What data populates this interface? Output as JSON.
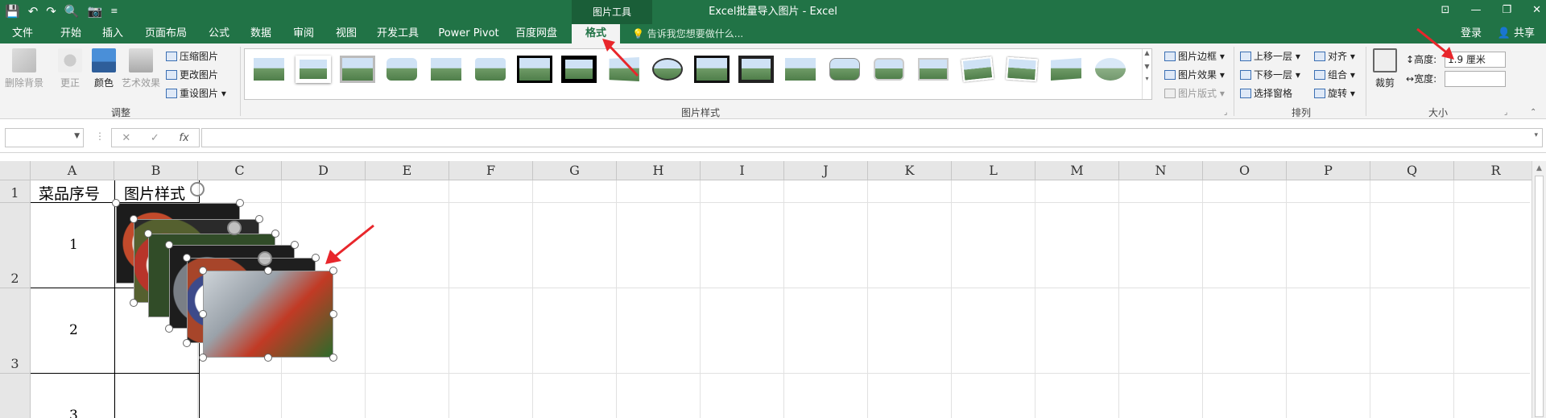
{
  "titlebar": {
    "title": "Excel批量导入图片 - Excel",
    "context_tab_group": "图片工具",
    "qat_more": "≡"
  },
  "tabs": [
    {
      "label": "文件"
    },
    {
      "label": "开始"
    },
    {
      "label": "插入"
    },
    {
      "label": "页面布局"
    },
    {
      "label": "公式"
    },
    {
      "label": "数据"
    },
    {
      "label": "审阅"
    },
    {
      "label": "视图"
    },
    {
      "label": "开发工具"
    },
    {
      "label": "Power Pivot"
    },
    {
      "label": "百度网盘"
    },
    {
      "label": "格式",
      "active": true
    }
  ],
  "tell_me": "告诉我您想要做什么...",
  "account": {
    "login": "登录",
    "share": "共享"
  },
  "ribbon": {
    "adjust": {
      "label": "调整",
      "remove_bg": "删除背景",
      "corrections": "更正",
      "color": "颜色",
      "artistic": "艺术效果",
      "compress": "压缩图片",
      "change": "更改图片",
      "reset": "重设图片"
    },
    "picture_styles": {
      "label": "图片样式",
      "border": "图片边框",
      "effects": "图片效果",
      "layout": "图片版式"
    },
    "arrange": {
      "label": "排列",
      "bring_forward": "上移一层",
      "send_backward": "下移一层",
      "selection_pane": "选择窗格",
      "align": "对齐",
      "group": "组合",
      "rotate": "旋转"
    },
    "size": {
      "label": "大小",
      "crop": "裁剪",
      "height_label": "高度:",
      "height_value": "1.9 厘米",
      "width_label": "宽度:",
      "width_value": ""
    }
  },
  "formula_bar": {
    "fx": "fx",
    "cancel": "✕",
    "enter": "✓"
  },
  "columns": [
    "A",
    "B",
    "C",
    "D",
    "E",
    "F",
    "G",
    "H",
    "I",
    "J",
    "K",
    "L",
    "M",
    "N",
    "O",
    "P",
    "Q",
    "R"
  ],
  "rows": [
    "1",
    "2",
    "3"
  ],
  "cells": {
    "A1": "菜品序号",
    "B1": "图片样式",
    "A2": "1",
    "A3": "2",
    "A4": "3"
  },
  "colors": {
    "excel_green": "#217346",
    "annotation_red": "#e8262b"
  }
}
